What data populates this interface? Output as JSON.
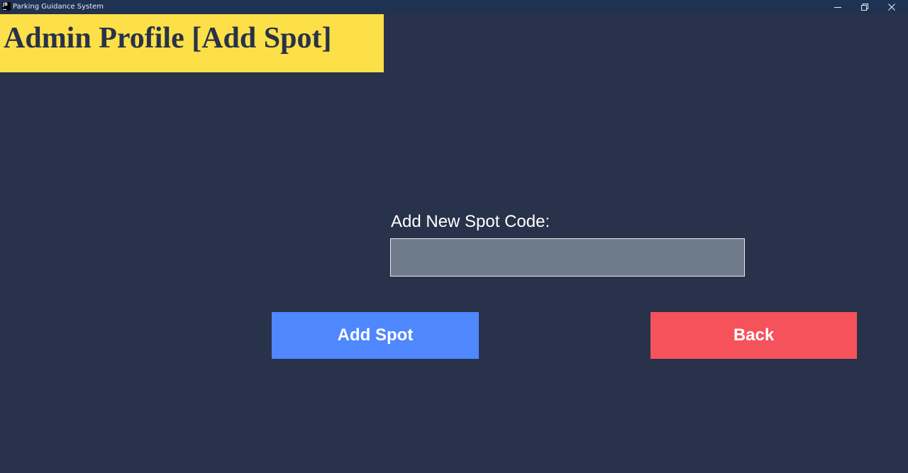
{
  "window": {
    "title": "Parking Guidance System",
    "icon_text": "JB"
  },
  "header": {
    "title": "Admin Profile [Add Spot]"
  },
  "form": {
    "label": "Add New Spot Code:",
    "input_value": "",
    "input_placeholder": ""
  },
  "buttons": {
    "add_label": "Add Spot",
    "back_label": "Back"
  },
  "colors": {
    "background": "#28324a",
    "titlebar": "#1f3252",
    "header_banner": "#fde047",
    "input_fill": "#6e7b8b",
    "add_button": "#4f87ff",
    "back_button": "#f5525b"
  },
  "icons": {
    "app": "jetbrains-app-icon",
    "minimize": "minimize-icon",
    "maximize": "restore-icon",
    "close": "close-icon"
  }
}
